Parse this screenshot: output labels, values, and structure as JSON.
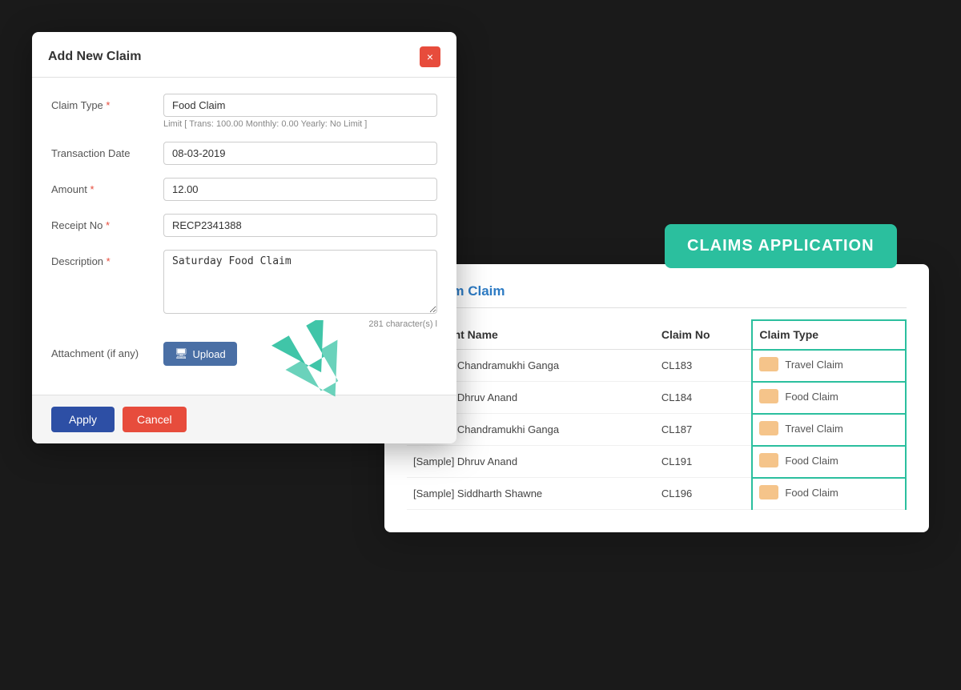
{
  "modal": {
    "title": "Add New Claim",
    "close_label": "×",
    "form": {
      "claim_type_label": "Claim Type",
      "claim_type_value": "Food Claim",
      "claim_type_limit": "Limit [ Trans: 100.00  Monthly: 0.00  Yearly: No Limit ]",
      "transaction_date_label": "Transaction Date",
      "transaction_date_value": "08-03-2019",
      "amount_label": "Amount",
      "amount_value": "12.00",
      "receipt_no_label": "Receipt No",
      "receipt_no_value": "RECP2341388",
      "description_label": "Description",
      "description_value": "Saturday Food Claim",
      "char_count": "281 character(s) l",
      "attachment_label": "Attachment (if any)",
      "upload_label": "Upload"
    },
    "apply_label": "Apply",
    "cancel_label": "Cancel"
  },
  "claims_badge": "CLAIMS APPLICATION",
  "claims_card": {
    "title": "My Team Claim",
    "table_headers": [
      "Applicant Name",
      "Claim No",
      "Claim Type"
    ],
    "rows": [
      {
        "applicant": "[Sample] Chandramukhi Ganga",
        "claim_no": "CL183",
        "claim_type": "Travel Claim"
      },
      {
        "applicant": "[Sample] Dhruv Anand",
        "claim_no": "CL184",
        "claim_type": "Food Claim"
      },
      {
        "applicant": "[Sample] Chandramukhi Ganga",
        "claim_no": "CL187",
        "claim_type": "Travel Claim"
      },
      {
        "applicant": "[Sample] Dhruv Anand",
        "claim_no": "CL191",
        "claim_type": "Food Claim"
      },
      {
        "applicant": "[Sample] Siddharth Shawne",
        "claim_no": "CL196",
        "claim_type": "Food Claim"
      }
    ]
  }
}
